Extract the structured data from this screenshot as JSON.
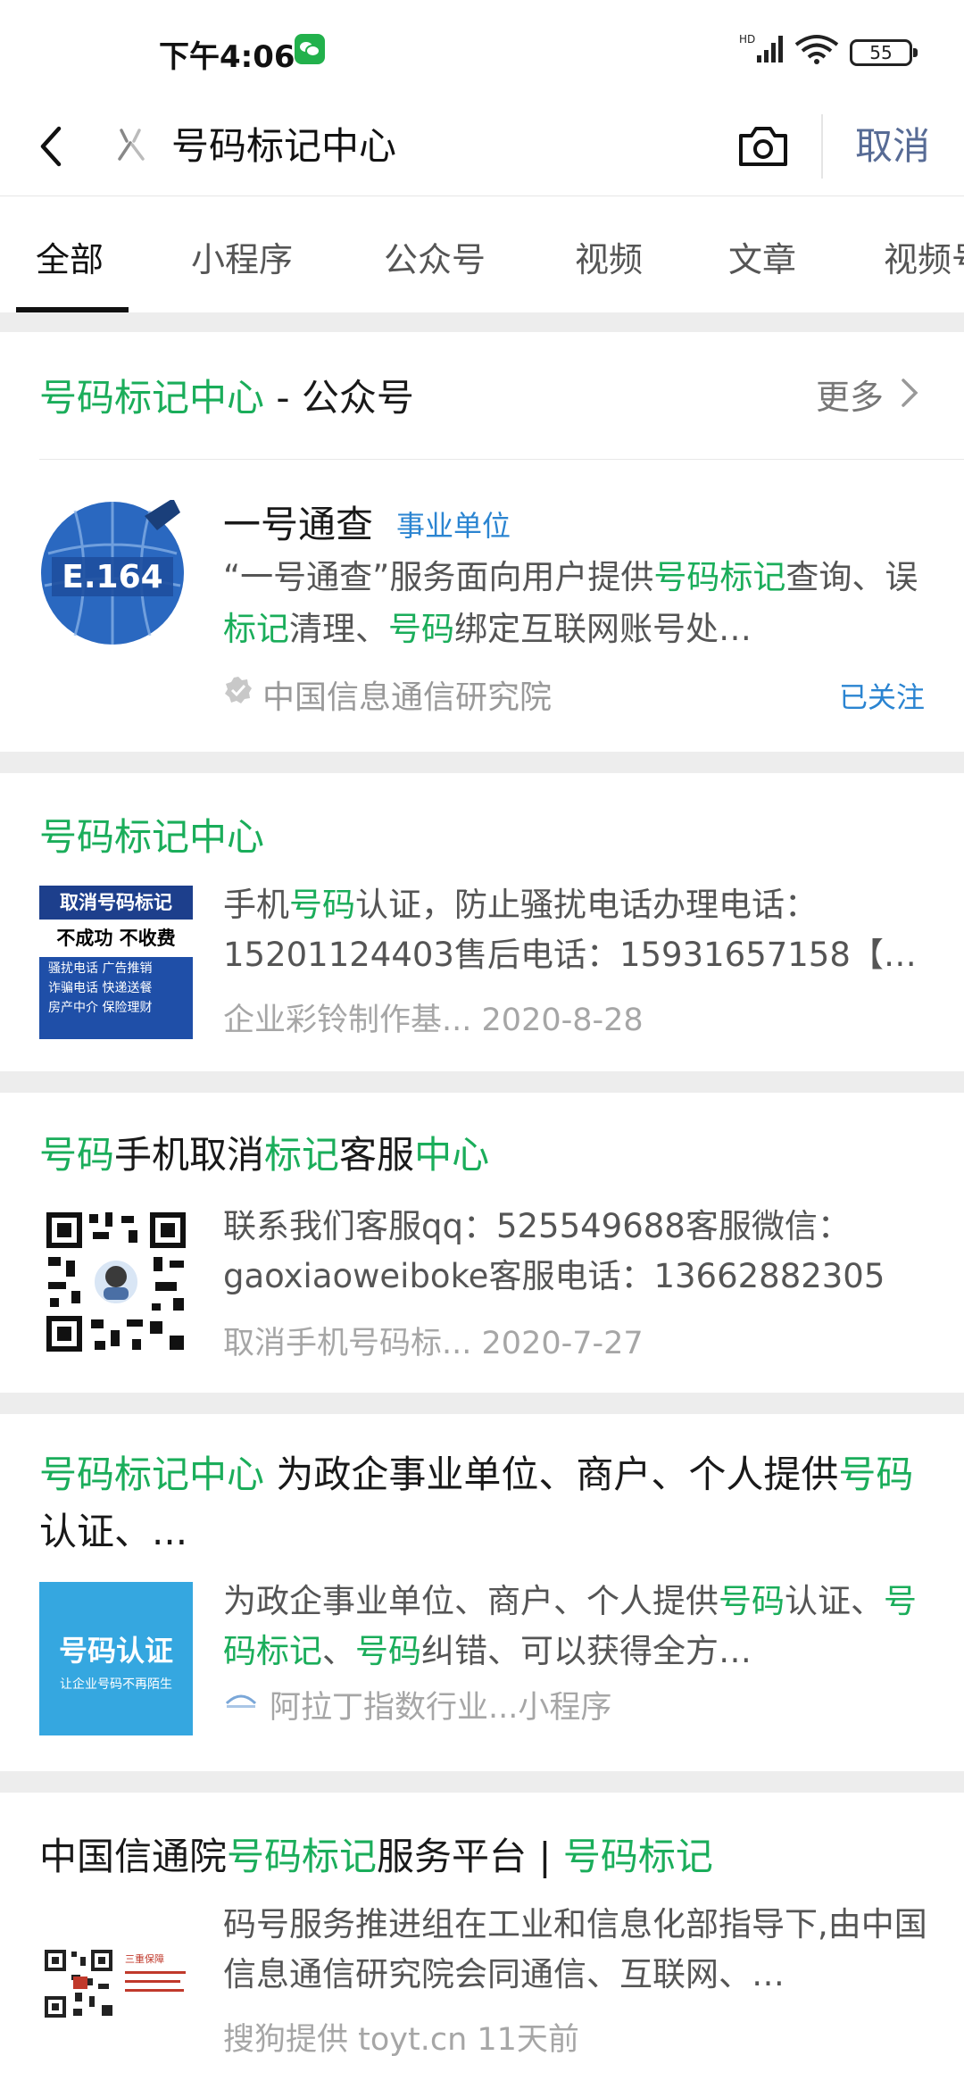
{
  "status": {
    "time": "下午4:06",
    "battery": "55"
  },
  "search": {
    "query": "号码标记中心",
    "cancel": "取消"
  },
  "tabs": [
    "全部",
    "小程序",
    "公众号",
    "视频",
    "文章",
    "视频号"
  ],
  "accent": "#1aad5a",
  "link_color": "#576b95",
  "card1": {
    "head_highlight": "号码标记中心",
    "head_rest": " - 公众号",
    "more": "更多",
    "name": "一号通查",
    "tag": "事业单位",
    "logo_text": "E.164",
    "desc_parts": [
      "“一号通查”服务面向用户提供",
      "号码标记",
      "查询、误",
      "标记",
      "清理、",
      "号码",
      "绑定互联网账号处…"
    ],
    "org": "中国信息通信研究院",
    "followed": "已关注"
  },
  "card2": {
    "title": "号码标记中心",
    "thumb": {
      "line1": "取消号码标记",
      "line2": "不成功 不收费",
      "items": [
        "骚扰电话  广告推销",
        "诈骗电话  快递送餐",
        "房产中介  保险理财"
      ]
    },
    "desc_parts": [
      "手机",
      "号码",
      "认证，防止骚扰电话办理电话：15201124403售后电话：15931657158【…"
    ],
    "source": "企业彩铃制作基...",
    "date": "2020-8-28"
  },
  "card3": {
    "title_parts": [
      "号码",
      "手机取消",
      "标记",
      "客服",
      "中心"
    ],
    "desc": "联系我们客服qq：525549688客服微信：gaoxiaoweiboke客服电话：13662882305",
    "source": "取消手机号码标...",
    "date": "2020-7-27"
  },
  "card4": {
    "title_parts": [
      "号码标记中心",
      " 为政企事业单位、商户、个人提供",
      "号码",
      "认证、..."
    ],
    "thumb": {
      "big": "号码认证",
      "small": "让企业号码不再陌生"
    },
    "desc_parts": [
      "为政企事业单位、商户、个人提供",
      "号码",
      "认证、",
      "号码标记",
      "、",
      "号码",
      "纠错、可以获得全方…"
    ],
    "source": "阿拉丁指数行业...小程序"
  },
  "card5": {
    "title_parts": [
      "中国信通院",
      "号码标记",
      "服务平台 | ",
      "号码标记"
    ],
    "desc": "码号服务推进组在工业和信息化部指导下,由中国信息通信研究院会同通信、互联网、…",
    "source": "搜狗提供 toyt.cn",
    "date": "11天前"
  }
}
